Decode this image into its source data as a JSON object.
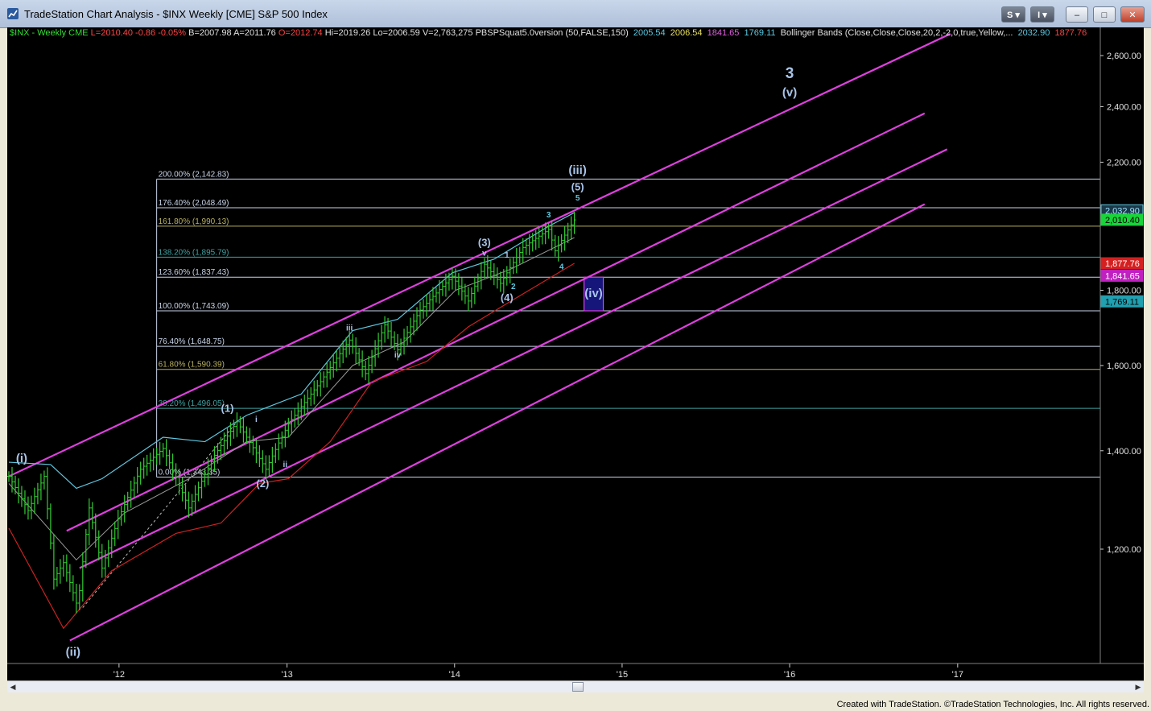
{
  "window": {
    "title": "TradeStation Chart Analysis - $INX Weekly [CME] S&P 500 Index",
    "buttons": [
      "S",
      "I",
      "–",
      "□",
      "✕"
    ]
  },
  "header": {
    "symbol": "$INX - Weekly",
    "exchange": "CME",
    "last": "L=2010.40",
    "change": "-0.86",
    "change_pct": "-0.05%",
    "bid": "B=2007.98",
    "ask": "A=2011.76",
    "open": "O=2012.74",
    "high": "Hi=2019.26",
    "low": "Lo=2006.59",
    "volume": "V=2,763,275",
    "indicator1": "PBSPSquat5.0version (50,FALSE,150)",
    "ind_v1": "2005.54",
    "ind_v2": "2006.54",
    "ind_v3": "1841.65",
    "ind_v4": "1769.11",
    "indicator2": "Bollinger Bands (Close,Close,Close,20,2,-2,0,true,Yellow,...",
    "bb_v1": "2032.90",
    "bb_v2": "1877.76"
  },
  "footer": "Created with TradeStation. ©TradeStation Technologies, Inc. All rights reserved.",
  "colors": {
    "background": "#000000",
    "price_bars": "#33cc33",
    "channel": "#e040e0",
    "bb_upper": "#5ec8e0",
    "bb_mid": "#9a9a9a",
    "bb_lower": "#cc2222",
    "wave_labels": "#a9c4e8",
    "fib_default": "#c8d4e8",
    "fib_gold": "#b8b060",
    "fib_teal": "#40a0a0"
  },
  "chart_data": {
    "type": "bar",
    "scale": "log",
    "ylim": [
      1000,
      2720
    ],
    "x_ticks": [
      "'12",
      "'13",
      "'14",
      "'15",
      "'16",
      "'17"
    ],
    "y_ticks": [
      "2,600.00",
      "2,400.00",
      "2,200.00",
      "1,800.00",
      "1,600.00",
      "1,400.00",
      "1,200.00"
    ],
    "price_path": [
      [
        "2011-05-06",
        1345
      ],
      [
        "2011-06-17",
        1275
      ],
      [
        "2011-07-22",
        1345
      ],
      [
        "2011-08-12",
        1145
      ],
      [
        "2011-09-02",
        1175
      ],
      [
        "2011-10-03",
        1095
      ],
      [
        "2011-10-28",
        1280
      ],
      [
        "2011-11-25",
        1165
      ],
      [
        "2011-12-30",
        1258
      ],
      [
        "2012-02-17",
        1360
      ],
      [
        "2012-04-06",
        1405
      ],
      [
        "2012-06-01",
        1280
      ],
      [
        "2012-07-27",
        1390
      ],
      [
        "2012-09-14",
        1465
      ],
      [
        "2012-11-16",
        1360
      ],
      [
        "2013-01-04",
        1460
      ],
      [
        "2013-03-15",
        1560
      ],
      [
        "2013-05-17",
        1665
      ],
      [
        "2013-06-21",
        1580
      ],
      [
        "2013-08-02",
        1705
      ],
      [
        "2013-08-30",
        1640
      ],
      [
        "2013-10-18",
        1745
      ],
      [
        "2013-12-27",
        1840
      ],
      [
        "2014-01-31",
        1770
      ],
      [
        "2014-03-07",
        1875
      ],
      [
        "2014-04-11",
        1820
      ],
      [
        "2014-05-30",
        1925
      ],
      [
        "2014-07-25",
        1980
      ],
      [
        "2014-08-08",
        1915
      ],
      [
        "2014-09-19",
        2010
      ]
    ],
    "bollinger_upper": [
      [
        "2011-05-06",
        1375
      ],
      [
        "2011-08-05",
        1370
      ],
      [
        "2011-09-30",
        1320
      ],
      [
        "2011-11-25",
        1340
      ],
      [
        "2012-04-06",
        1430
      ],
      [
        "2012-07-06",
        1420
      ],
      [
        "2012-10-05",
        1480
      ],
      [
        "2013-02-01",
        1530
      ],
      [
        "2013-05-24",
        1690
      ],
      [
        "2013-08-30",
        1720
      ],
      [
        "2013-12-27",
        1850
      ],
      [
        "2014-03-28",
        1890
      ],
      [
        "2014-07-25",
        1990
      ],
      [
        "2014-09-19",
        2032.9
      ]
    ],
    "bollinger_mid": [
      [
        "2011-05-06",
        1330
      ],
      [
        "2011-09-30",
        1180
      ],
      [
        "2012-01-13",
        1270
      ],
      [
        "2012-06-01",
        1340
      ],
      [
        "2012-10-05",
        1420
      ],
      [
        "2013-01-04",
        1430
      ],
      [
        "2013-05-24",
        1600
      ],
      [
        "2013-09-13",
        1660
      ],
      [
        "2014-01-03",
        1800
      ],
      [
        "2014-05-02",
        1860
      ],
      [
        "2014-09-19",
        1955
      ]
    ],
    "bollinger_lower": [
      [
        "2011-05-06",
        1240
      ],
      [
        "2011-09-02",
        1060
      ],
      [
        "2011-12-16",
        1160
      ],
      [
        "2012-05-04",
        1230
      ],
      [
        "2012-08-10",
        1250
      ],
      [
        "2012-11-02",
        1330
      ],
      [
        "2013-01-04",
        1340
      ],
      [
        "2013-04-05",
        1420
      ],
      [
        "2013-07-05",
        1560
      ],
      [
        "2013-11-01",
        1610
      ],
      [
        "2014-01-31",
        1700
      ],
      [
        "2014-05-30",
        1790
      ],
      [
        "2014-09-19",
        1877.76
      ]
    ],
    "channels": [
      [
        [
          "2011-05-06",
          1345
        ],
        [
          "2016-12-16",
          2690
        ]
      ],
      [
        [
          "2011-09-09",
          1235
        ],
        [
          "2016-10-21",
          2375
        ]
      ],
      [
        [
          "2011-10-07",
          1165
        ],
        [
          "2016-12-09",
          2245
        ]
      ],
      [
        [
          "2011-09-16",
          1040
        ],
        [
          "2016-10-21",
          2060
        ]
      ]
    ],
    "fib_levels": [
      {
        "label": "200.00% (2,142.83)",
        "value": 2142.83,
        "tone": "default"
      },
      {
        "label": "176.40% (2,048.49)",
        "value": 2048.49,
        "tone": "default"
      },
      {
        "label": "161.80% (1,990.13)",
        "value": 1990.13,
        "tone": "gold"
      },
      {
        "label": "138.20% (1,895.79)",
        "value": 1895.79,
        "tone": "teal"
      },
      {
        "label": "123.60% (1,837.43)",
        "value": 1837.43,
        "tone": "default"
      },
      {
        "label": "100.00% (1,743.09)",
        "value": 1743.09,
        "tone": "default"
      },
      {
        "label": "76.40% (1,648.75)",
        "value": 1648.75,
        "tone": "default"
      },
      {
        "label": "61.80% (1,590.39)",
        "value": 1590.39,
        "tone": "gold"
      },
      {
        "label": "38.20% (1,496.05)",
        "value": 1496.05,
        "tone": "teal"
      },
      {
        "label": "0.00% (1,343.35)",
        "value": 1343.35,
        "tone": "default"
      }
    ],
    "fib_start": "2012-03-23",
    "projection_line": [
      [
        "2011-10-14",
        1095
      ],
      [
        "2012-09-14",
        1465
      ]
    ],
    "target_box": {
      "x1": "2014-10-10",
      "x2": "2014-11-21",
      "y1": 1743.09,
      "y2": 1837.43,
      "label": "(iv)"
    },
    "price_tags": [
      {
        "text": "2,032.90",
        "value": 2040,
        "bg": "#1a3a4a",
        "fg": "#9fe0ff",
        "border": "#5ec8e0"
      },
      {
        "text": "2,010.40",
        "value": 2010.4,
        "bg": "#19d43a",
        "fg": "#000000",
        "border": "#19d43a"
      },
      {
        "text": "1,877.76",
        "value": 1877.76,
        "bg": "#d42020",
        "fg": "#ffffff",
        "border": "#d42020"
      },
      {
        "text": "1,841.65",
        "value": 1841.65,
        "bg": "#c020c0",
        "fg": "#ffffff",
        "border": "#c020c0"
      },
      {
        "text": "1,769.11",
        "value": 1769.11,
        "bg": "#20a0b0",
        "fg": "#000000",
        "border": "#20a0b0"
      }
    ],
    "wave_labels": [
      {
        "text": "(i)",
        "x": "2011-06-03",
        "y": 1375,
        "size": 15,
        "color": "#a9c4e8"
      },
      {
        "text": "(ii)",
        "x": "2011-09-23",
        "y": 1015,
        "size": 15,
        "color": "#a9c4e8"
      },
      {
        "text": "(1)",
        "x": "2012-08-24",
        "y": 1488,
        "size": 13,
        "color": "#a9c4e8"
      },
      {
        "text": "(2)",
        "x": "2012-11-09",
        "y": 1322,
        "size": 13,
        "color": "#a9c4e8"
      },
      {
        "text": "i",
        "x": "2012-10-26",
        "y": 1465,
        "size": 10,
        "color": "#a9c4e8"
      },
      {
        "text": "ii",
        "x": "2012-12-28",
        "y": 1365,
        "size": 10,
        "color": "#a9c4e8"
      },
      {
        "text": "iii",
        "x": "2013-05-17",
        "y": 1690,
        "size": 10,
        "color": "#a9c4e8"
      },
      {
        "text": "iv",
        "x": "2013-08-30",
        "y": 1620,
        "size": 10,
        "color": "#a9c4e8"
      },
      {
        "text": "(3)",
        "x": "2014-03-07",
        "y": 1930,
        "size": 13,
        "color": "#a9c4e8"
      },
      {
        "text": "v",
        "x": "2014-03-07",
        "y": 1900,
        "size": 10,
        "color": "#a9c4e8"
      },
      {
        "text": "1",
        "x": "2014-04-25",
        "y": 1895,
        "size": 10,
        "color": "#a9c4e8"
      },
      {
        "text": "2",
        "x": "2014-05-09",
        "y": 1803,
        "size": 10,
        "color": "#5ec8e0"
      },
      {
        "text": "(4)",
        "x": "2014-04-25",
        "y": 1770,
        "size": 13,
        "color": "#a9c4e8"
      },
      {
        "text": "3",
        "x": "2014-07-25",
        "y": 2018,
        "size": 10,
        "color": "#5ec8e0"
      },
      {
        "text": "4",
        "x": "2014-08-22",
        "y": 1860,
        "size": 10,
        "color": "#5ec8e0"
      },
      {
        "text": "5",
        "x": "2014-09-26",
        "y": 2072,
        "size": 10,
        "color": "#5ec8e0"
      },
      {
        "text": "(5)",
        "x": "2014-09-26",
        "y": 2105,
        "size": 13,
        "color": "#a9c4e8"
      },
      {
        "text": "(iii)",
        "x": "2014-09-26",
        "y": 2160,
        "size": 15,
        "color": "#a9c4e8"
      },
      {
        "text": "(v)",
        "x": "2016-01-01",
        "y": 2440,
        "size": 15,
        "color": "#a9c4e8"
      },
      {
        "text": "3",
        "x": "2016-01-01",
        "y": 2510,
        "size": 19,
        "color": "#a9c4e8"
      }
    ]
  }
}
